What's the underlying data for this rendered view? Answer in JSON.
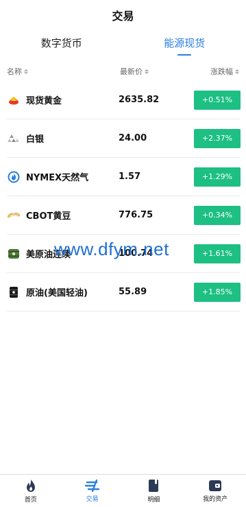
{
  "header": {
    "title": "交易"
  },
  "tabs": [
    {
      "label": "数字货币",
      "active": false
    },
    {
      "label": "能源现货",
      "active": true
    }
  ],
  "columns": {
    "name": "名称",
    "price": "最新价",
    "change": "涨跌幅"
  },
  "rows": [
    {
      "name": "现货黄金",
      "price": "2635.82",
      "change": "+0.51%",
      "icon": "gold-icon"
    },
    {
      "name": "白银",
      "price": "24.00",
      "change": "+2.37%",
      "icon": "silver-icon"
    },
    {
      "name": "NYMEX天然气",
      "price": "1.57",
      "change": "+1.29%",
      "icon": "gas-flame-icon"
    },
    {
      "name": "CBOT黄豆",
      "price": "776.75",
      "change": "+0.34%",
      "icon": "soybean-icon"
    },
    {
      "name": "美原油连续",
      "price": "100.74",
      "change": "+1.61%",
      "icon": "oil-barrel-green-icon"
    },
    {
      "name": "原油(美国轻油)",
      "price": "55.89",
      "change": "+1.85%",
      "icon": "oil-barrel-black-icon"
    }
  ],
  "watermark": "www.dfym.net",
  "colors": {
    "accent": "#2a7ee0",
    "up": "#1dbf83"
  },
  "tabbar": [
    {
      "label": "首页",
      "icon": "flame-icon",
      "active": false
    },
    {
      "label": "交易",
      "icon": "trade-icon",
      "active": true
    },
    {
      "label": "明细",
      "icon": "book-icon",
      "active": false
    },
    {
      "label": "我的资产",
      "icon": "wallet-icon",
      "active": false
    }
  ]
}
